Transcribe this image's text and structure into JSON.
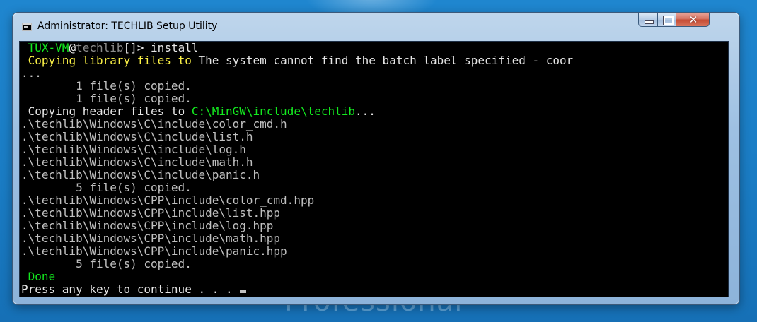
{
  "desktop": {
    "brand_text": "Professional"
  },
  "window": {
    "title": "Administrator:  TECHLIB Setup Utility",
    "controls": {
      "minimize": "minimize",
      "maximize": "maximize",
      "close": "✕"
    }
  },
  "console": {
    "prompt": {
      "host": "TUX-VM",
      "at": "@",
      "path": "techlib",
      "suffix": "[]> ",
      "command": "install"
    },
    "copy_lib_prefix": "Copying library files to ",
    "copy_lib_error": "The system cannot find the batch label specified - coor",
    "ellipsis": "...",
    "file_copied_1a": "        1 file(s) copied.",
    "file_copied_1b": "        1 file(s) copied.",
    "copy_header_prefix": "Copying header files to ",
    "copy_header_dest": "C:\\MinGW\\include\\techlib",
    "copy_header_suffix": "...",
    "c_files": [
      ".\\techlib\\Windows\\C\\include\\color_cmd.h",
      ".\\techlib\\Windows\\C\\include\\list.h",
      ".\\techlib\\Windows\\C\\include\\log.h",
      ".\\techlib\\Windows\\C\\include\\math.h",
      ".\\techlib\\Windows\\C\\include\\panic.h"
    ],
    "c_copied": "        5 file(s) copied.",
    "cpp_files": [
      ".\\techlib\\Windows\\CPP\\include\\color_cmd.hpp",
      ".\\techlib\\Windows\\CPP\\include\\list.hpp",
      ".\\techlib\\Windows\\CPP\\include\\log.hpp",
      ".\\techlib\\Windows\\CPP\\include\\math.hpp",
      ".\\techlib\\Windows\\CPP\\include\\panic.hpp"
    ],
    "cpp_copied": "        5 file(s) copied.",
    "done": "Done",
    "press_key": "Press any key to continue . . . "
  },
  "colors": {
    "console_bg": "#000000",
    "console_text": "#c0c0c0",
    "green": "#13e91f",
    "yellow": "#fbf146",
    "desktop_bg": "#1a7cc4"
  }
}
